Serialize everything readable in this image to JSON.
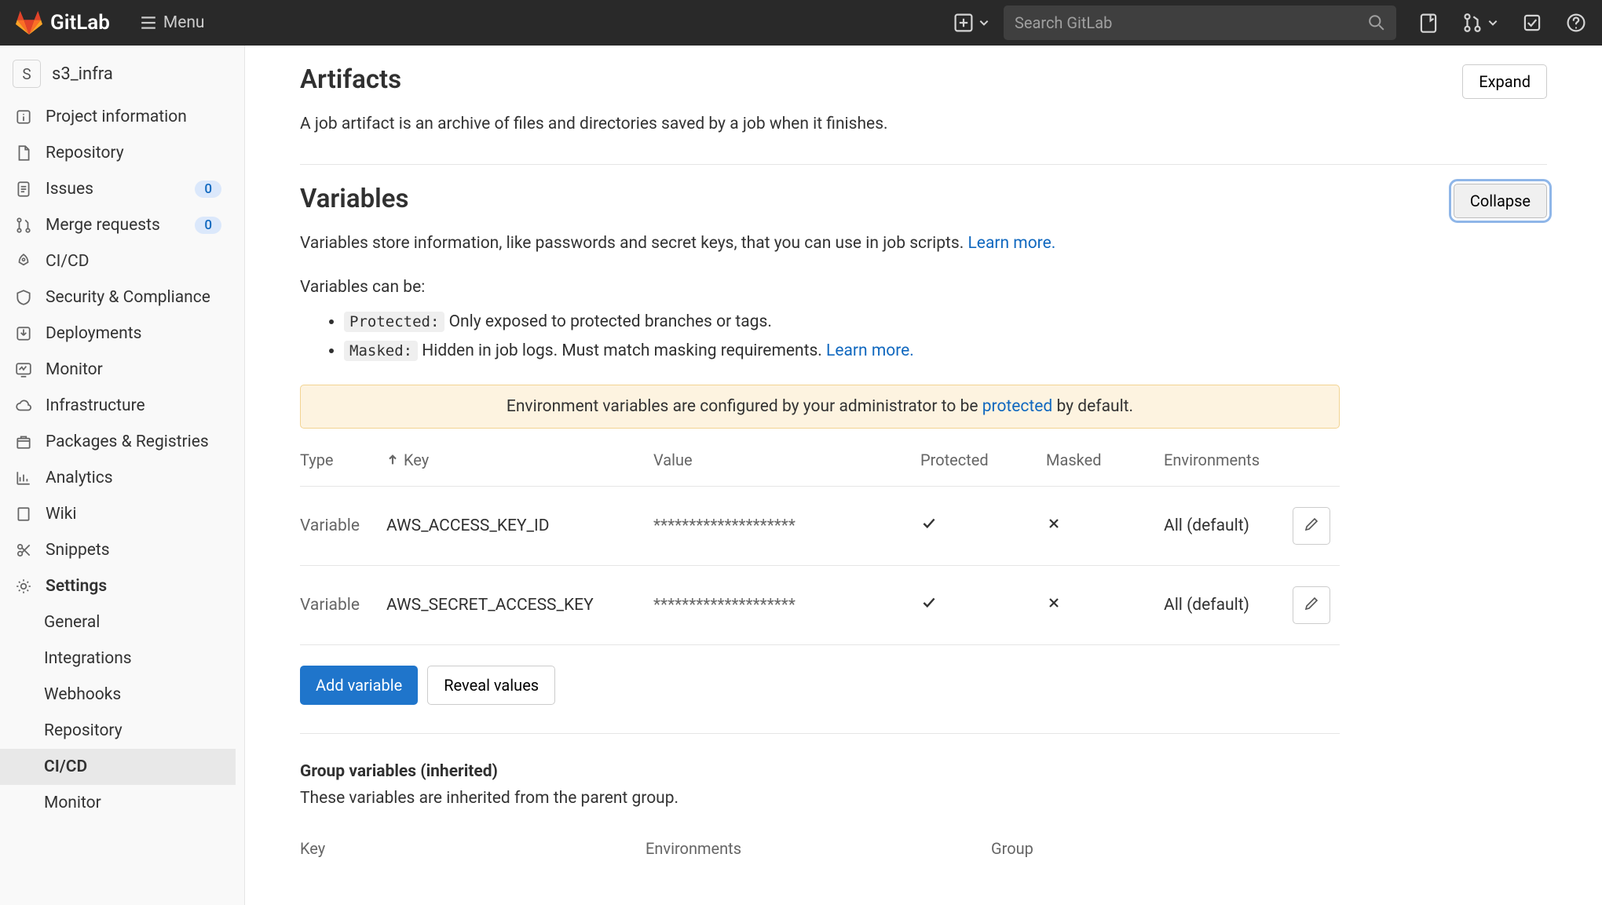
{
  "topbar": {
    "brand": "GitLab",
    "menu_label": "Menu",
    "search_placeholder": "Search GitLab"
  },
  "project": {
    "avatar_letter": "S",
    "name": "s3_infra"
  },
  "sidebar": {
    "items": [
      {
        "id": "project-information",
        "label": "Project information"
      },
      {
        "id": "repository",
        "label": "Repository"
      },
      {
        "id": "issues",
        "label": "Issues",
        "badge": "0"
      },
      {
        "id": "merge-requests",
        "label": "Merge requests",
        "badge": "0"
      },
      {
        "id": "cicd",
        "label": "CI/CD"
      },
      {
        "id": "security",
        "label": "Security & Compliance"
      },
      {
        "id": "deployments",
        "label": "Deployments"
      },
      {
        "id": "monitor",
        "label": "Monitor"
      },
      {
        "id": "infrastructure",
        "label": "Infrastructure"
      },
      {
        "id": "packages",
        "label": "Packages & Registries"
      },
      {
        "id": "analytics",
        "label": "Analytics"
      },
      {
        "id": "wiki",
        "label": "Wiki"
      },
      {
        "id": "snippets",
        "label": "Snippets"
      },
      {
        "id": "settings",
        "label": "Settings",
        "bold": true
      }
    ],
    "settings_sub": [
      {
        "id": "general",
        "label": "General"
      },
      {
        "id": "integrations",
        "label": "Integrations"
      },
      {
        "id": "webhooks",
        "label": "Webhooks"
      },
      {
        "id": "repository",
        "label": "Repository"
      },
      {
        "id": "cicd",
        "label": "CI/CD",
        "active": true
      },
      {
        "id": "monitor",
        "label": "Monitor"
      }
    ]
  },
  "artifacts": {
    "title": "Artifacts",
    "description": "A job artifact is an archive of files and directories saved by a job when it finishes.",
    "expand_label": "Expand"
  },
  "variables": {
    "title": "Variables",
    "collapse_label": "Collapse",
    "desc_pre": "Variables store information, like passwords and secret keys, that you can use in job scripts. ",
    "learn_more": "Learn more.",
    "can_be": "Variables can be:",
    "protected_chip": "Protected:",
    "protected_text": " Only exposed to protected branches or tags.",
    "masked_chip": "Masked:",
    "masked_text": " Hidden in job logs. Must match masking requirements. ",
    "alert_pre": "Environment variables are configured by your administrator to be ",
    "alert_link": "protected",
    "alert_post": " by default.",
    "columns": {
      "type": "Type",
      "key": "Key",
      "value": "Value",
      "protected": "Protected",
      "masked": "Masked",
      "environments": "Environments"
    },
    "rows": [
      {
        "type": "Variable",
        "key": "AWS_ACCESS_KEY_ID",
        "value": "********************",
        "protected": true,
        "masked": false,
        "environments": "All (default)"
      },
      {
        "type": "Variable",
        "key": "AWS_SECRET_ACCESS_KEY",
        "value": "********************",
        "protected": true,
        "masked": false,
        "environments": "All (default)"
      }
    ],
    "add_label": "Add variable",
    "reveal_label": "Reveal values"
  },
  "group_vars": {
    "title": "Group variables (inherited)",
    "description": "These variables are inherited from the parent group.",
    "columns": {
      "key": "Key",
      "environments": "Environments",
      "group": "Group"
    }
  }
}
